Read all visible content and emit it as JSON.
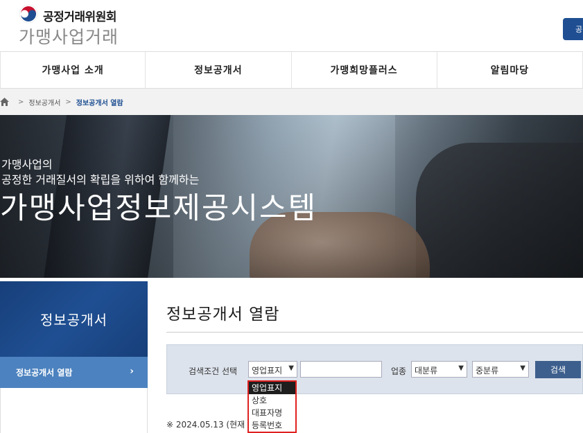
{
  "header": {
    "org_name": "공정거래위원회",
    "site_name": "가맹사업거래",
    "top_button_label": "공"
  },
  "gnb": {
    "items": [
      {
        "label": "가맹사업 소개"
      },
      {
        "label": "정보공개서"
      },
      {
        "label": "가맹희망플러스"
      },
      {
        "label": "알림마당"
      }
    ]
  },
  "breadcrumb": {
    "home_icon": "home-icon",
    "level1": "정보공개서",
    "current": "정보공개서 열람"
  },
  "hero": {
    "subtitle_line1": "가맹사업의",
    "subtitle_line2": "공정한 거래질서의 확립을 위하여 함께하는",
    "title": "가맹사업정보제공시스템"
  },
  "lnb": {
    "heading": "정보공개서",
    "items": [
      {
        "label": "정보공개서 열람",
        "arrow": "›"
      }
    ]
  },
  "content": {
    "page_title": "정보공개서 열람",
    "search": {
      "condition_label": "검색조건 선택",
      "condition_selected": "영업표지",
      "keyword_value": "",
      "industry_label": "업종",
      "major_category": "대분류",
      "minor_category": "중분류",
      "search_button": "검색"
    },
    "dropdown_options": [
      {
        "label": "영업표지",
        "selected": true
      },
      {
        "label": "상호",
        "selected": false
      },
      {
        "label": "대표자명",
        "selected": false
      },
      {
        "label": "등록번호",
        "selected": false
      }
    ],
    "notice": "※ 2024.05.13 (현재"
  },
  "colors": {
    "primary": "#1f4f92",
    "lnb_active": "#4c82bf",
    "search_bg": "#dde3ec",
    "button": "#3d5f8d",
    "highlight_border": "#e02020"
  }
}
